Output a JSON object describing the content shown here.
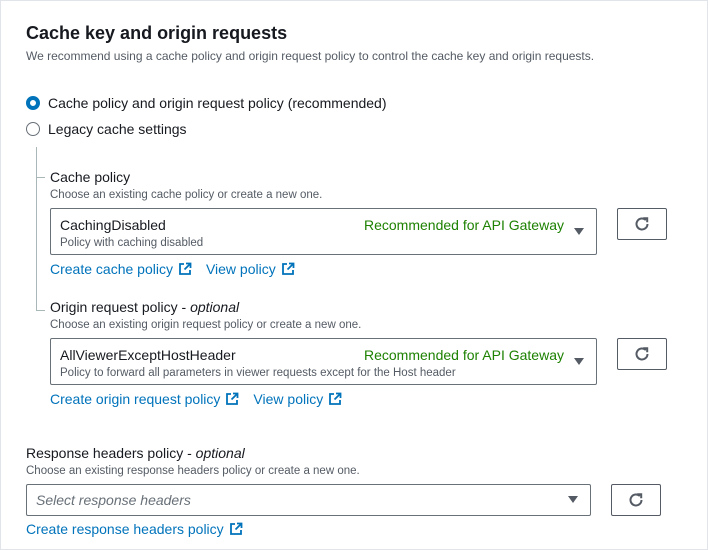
{
  "section": {
    "title": "Cache key and origin requests",
    "description": "We recommend using a cache policy and origin request policy to control the cache key and origin requests."
  },
  "options": [
    {
      "label": "Cache policy and origin request policy (recommended)",
      "selected": true
    },
    {
      "label": "Legacy cache settings",
      "selected": false
    }
  ],
  "cache_policy": {
    "label": "Cache policy",
    "description": "Choose an existing cache policy or create a new one.",
    "selected_value": "CachingDisabled",
    "selected_description": "Policy with caching disabled",
    "tag": "Recommended for API Gateway",
    "create_link": "Create cache policy",
    "view_link": "View policy"
  },
  "origin_request_policy": {
    "label": "Origin request policy",
    "optional": "optional",
    "separator": " - ",
    "description": "Choose an existing origin request policy or create a new one.",
    "selected_value": "AllViewerExceptHostHeader",
    "selected_description": "Policy to forward all parameters in viewer requests except for the Host header",
    "tag": "Recommended for API Gateway",
    "create_link": "Create origin request policy",
    "view_link": "View policy"
  },
  "response_headers_policy": {
    "label": "Response headers policy",
    "optional": "optional",
    "separator": " - ",
    "description": "Choose an existing response headers policy or create a new one.",
    "placeholder": "Select response headers",
    "create_link": "Create response headers policy"
  },
  "colors": {
    "accent": "#0073bb",
    "recommended": "#1d8102",
    "text": "#16191f",
    "secondary_text": "#545b64"
  },
  "icons": {
    "refresh": "refresh-icon",
    "external": "external-link-icon",
    "dropdown": "caret-down-icon"
  }
}
